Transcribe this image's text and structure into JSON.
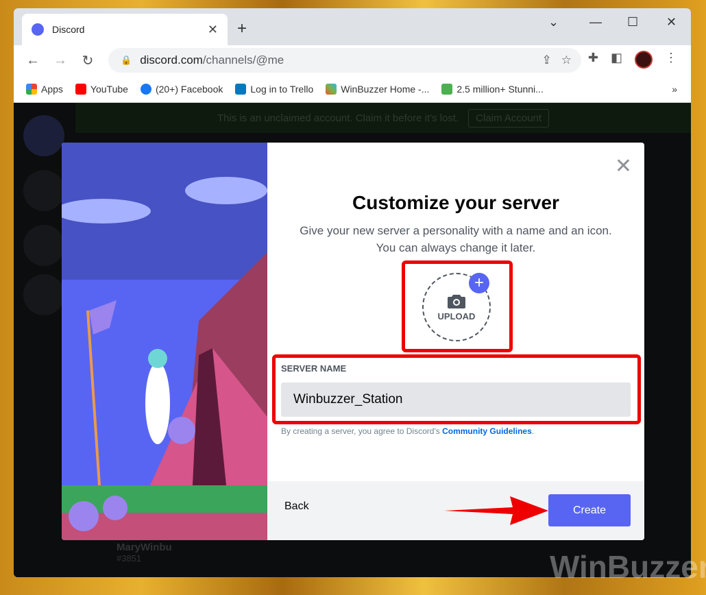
{
  "browser": {
    "tab_title": "Discord",
    "url_domain": "discord.com",
    "url_path": "/channels/@me",
    "bookmarks": [
      {
        "label": "Apps",
        "color": "#ea4335"
      },
      {
        "label": "YouTube",
        "color": "#ff0000"
      },
      {
        "label": "(20+) Facebook",
        "color": "#1877f2"
      },
      {
        "label": "Log in to Trello",
        "color": "#0079bf"
      },
      {
        "label": "WinBuzzer Home -...",
        "color": "#7cb342"
      },
      {
        "label": "2.5 million+ Stunni...",
        "color": "#4caf50"
      }
    ],
    "more": "»"
  },
  "banner": {
    "text": "This is an unclaimed account. Claim it before it's lost.",
    "button": "Claim Account"
  },
  "user": {
    "name": "MaryWinbu",
    "tag": "#3851"
  },
  "modal": {
    "title": "Customize your server",
    "subtitle": "Give your new server a personality with a name and an icon. You can always change it later.",
    "upload_label": "UPLOAD",
    "server_name_label": "SERVER NAME",
    "server_name_value": "Winbuzzer_Station",
    "terms_prefix": "By creating a server, you agree to Discord's ",
    "terms_link": "Community Guidelines",
    "terms_suffix": ".",
    "back": "Back",
    "create": "Create"
  },
  "watermark": "WinBuzzer",
  "colors": {
    "accent": "#5865f2",
    "highlight": "#ee0000"
  }
}
